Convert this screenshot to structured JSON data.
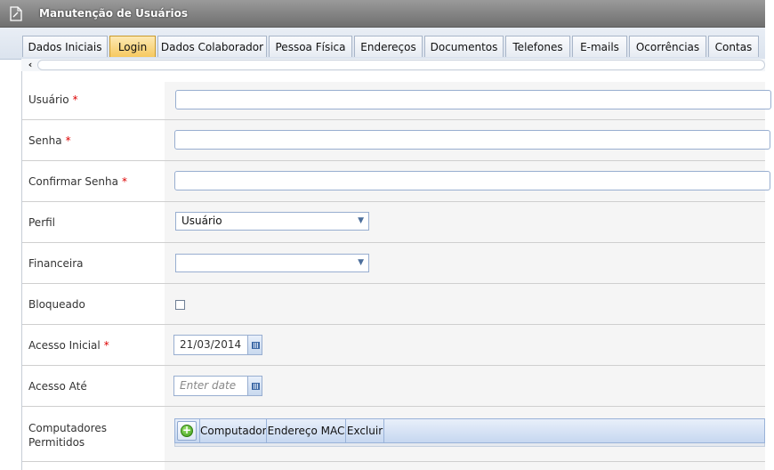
{
  "window": {
    "title": "Manutenção de Usuários",
    "icon": "document-edit-icon"
  },
  "tabs": [
    {
      "label": "Dados Iniciais",
      "active": false
    },
    {
      "label": "Login",
      "active": true
    },
    {
      "label": "Dados Colaborador",
      "active": false
    },
    {
      "label": "Pessoa Física",
      "active": false
    },
    {
      "label": "Endereços",
      "active": false
    },
    {
      "label": "Documentos",
      "active": false
    },
    {
      "label": "Telefones",
      "active": false
    },
    {
      "label": "E-mails",
      "active": false
    },
    {
      "label": "Ocorrências",
      "active": false
    },
    {
      "label": "Contas",
      "active": false
    }
  ],
  "scroll": {
    "left_arrow": "‹"
  },
  "form": {
    "usuario": {
      "label": "Usuário",
      "required": "*",
      "value": ""
    },
    "senha": {
      "label": "Senha",
      "required": "*",
      "value": ""
    },
    "confirmar": {
      "label": "Confirmar Senha",
      "required": "*",
      "value": ""
    },
    "perfil": {
      "label": "Perfil",
      "value": "Usuário"
    },
    "financeira": {
      "label": "Financeira",
      "value": ""
    },
    "bloqueado": {
      "label": "Bloqueado",
      "checked": false
    },
    "acesso_inicial": {
      "label": "Acesso Inicial",
      "required": "*",
      "value": "21/03/2014"
    },
    "acesso_ate": {
      "label": "Acesso Até",
      "placeholder": "Enter date",
      "value": ""
    },
    "computadores": {
      "label_line1": "Computadores",
      "label_line2": "Permitidos",
      "columns": [
        "Computador",
        "Endereço MAC",
        "Excluir"
      ]
    }
  },
  "colors": {
    "active_tab": "#f6c960",
    "required": "#dd0000",
    "input_border": "#98aed0",
    "titlebar": "#7f7f7f"
  }
}
